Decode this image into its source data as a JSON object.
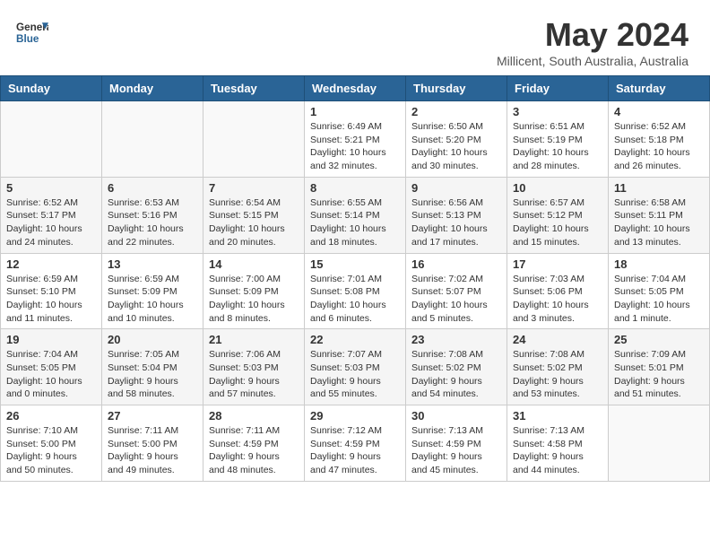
{
  "header": {
    "logo_line1": "General",
    "logo_line2": "Blue",
    "month_year": "May 2024",
    "location": "Millicent, South Australia, Australia"
  },
  "days_of_week": [
    "Sunday",
    "Monday",
    "Tuesday",
    "Wednesday",
    "Thursday",
    "Friday",
    "Saturday"
  ],
  "weeks": [
    [
      {
        "day": "",
        "info": ""
      },
      {
        "day": "",
        "info": ""
      },
      {
        "day": "",
        "info": ""
      },
      {
        "day": "1",
        "info": "Sunrise: 6:49 AM\nSunset: 5:21 PM\nDaylight: 10 hours\nand 32 minutes."
      },
      {
        "day": "2",
        "info": "Sunrise: 6:50 AM\nSunset: 5:20 PM\nDaylight: 10 hours\nand 30 minutes."
      },
      {
        "day": "3",
        "info": "Sunrise: 6:51 AM\nSunset: 5:19 PM\nDaylight: 10 hours\nand 28 minutes."
      },
      {
        "day": "4",
        "info": "Sunrise: 6:52 AM\nSunset: 5:18 PM\nDaylight: 10 hours\nand 26 minutes."
      }
    ],
    [
      {
        "day": "5",
        "info": "Sunrise: 6:52 AM\nSunset: 5:17 PM\nDaylight: 10 hours\nand 24 minutes."
      },
      {
        "day": "6",
        "info": "Sunrise: 6:53 AM\nSunset: 5:16 PM\nDaylight: 10 hours\nand 22 minutes."
      },
      {
        "day": "7",
        "info": "Sunrise: 6:54 AM\nSunset: 5:15 PM\nDaylight: 10 hours\nand 20 minutes."
      },
      {
        "day": "8",
        "info": "Sunrise: 6:55 AM\nSunset: 5:14 PM\nDaylight: 10 hours\nand 18 minutes."
      },
      {
        "day": "9",
        "info": "Sunrise: 6:56 AM\nSunset: 5:13 PM\nDaylight: 10 hours\nand 17 minutes."
      },
      {
        "day": "10",
        "info": "Sunrise: 6:57 AM\nSunset: 5:12 PM\nDaylight: 10 hours\nand 15 minutes."
      },
      {
        "day": "11",
        "info": "Sunrise: 6:58 AM\nSunset: 5:11 PM\nDaylight: 10 hours\nand 13 minutes."
      }
    ],
    [
      {
        "day": "12",
        "info": "Sunrise: 6:59 AM\nSunset: 5:10 PM\nDaylight: 10 hours\nand 11 minutes."
      },
      {
        "day": "13",
        "info": "Sunrise: 6:59 AM\nSunset: 5:09 PM\nDaylight: 10 hours\nand 10 minutes."
      },
      {
        "day": "14",
        "info": "Sunrise: 7:00 AM\nSunset: 5:09 PM\nDaylight: 10 hours\nand 8 minutes."
      },
      {
        "day": "15",
        "info": "Sunrise: 7:01 AM\nSunset: 5:08 PM\nDaylight: 10 hours\nand 6 minutes."
      },
      {
        "day": "16",
        "info": "Sunrise: 7:02 AM\nSunset: 5:07 PM\nDaylight: 10 hours\nand 5 minutes."
      },
      {
        "day": "17",
        "info": "Sunrise: 7:03 AM\nSunset: 5:06 PM\nDaylight: 10 hours\nand 3 minutes."
      },
      {
        "day": "18",
        "info": "Sunrise: 7:04 AM\nSunset: 5:05 PM\nDaylight: 10 hours\nand 1 minute."
      }
    ],
    [
      {
        "day": "19",
        "info": "Sunrise: 7:04 AM\nSunset: 5:05 PM\nDaylight: 10 hours\nand 0 minutes."
      },
      {
        "day": "20",
        "info": "Sunrise: 7:05 AM\nSunset: 5:04 PM\nDaylight: 9 hours\nand 58 minutes."
      },
      {
        "day": "21",
        "info": "Sunrise: 7:06 AM\nSunset: 5:03 PM\nDaylight: 9 hours\nand 57 minutes."
      },
      {
        "day": "22",
        "info": "Sunrise: 7:07 AM\nSunset: 5:03 PM\nDaylight: 9 hours\nand 55 minutes."
      },
      {
        "day": "23",
        "info": "Sunrise: 7:08 AM\nSunset: 5:02 PM\nDaylight: 9 hours\nand 54 minutes."
      },
      {
        "day": "24",
        "info": "Sunrise: 7:08 AM\nSunset: 5:02 PM\nDaylight: 9 hours\nand 53 minutes."
      },
      {
        "day": "25",
        "info": "Sunrise: 7:09 AM\nSunset: 5:01 PM\nDaylight: 9 hours\nand 51 minutes."
      }
    ],
    [
      {
        "day": "26",
        "info": "Sunrise: 7:10 AM\nSunset: 5:00 PM\nDaylight: 9 hours\nand 50 minutes."
      },
      {
        "day": "27",
        "info": "Sunrise: 7:11 AM\nSunset: 5:00 PM\nDaylight: 9 hours\nand 49 minutes."
      },
      {
        "day": "28",
        "info": "Sunrise: 7:11 AM\nSunset: 4:59 PM\nDaylight: 9 hours\nand 48 minutes."
      },
      {
        "day": "29",
        "info": "Sunrise: 7:12 AM\nSunset: 4:59 PM\nDaylight: 9 hours\nand 47 minutes."
      },
      {
        "day": "30",
        "info": "Sunrise: 7:13 AM\nSunset: 4:59 PM\nDaylight: 9 hours\nand 45 minutes."
      },
      {
        "day": "31",
        "info": "Sunrise: 7:13 AM\nSunset: 4:58 PM\nDaylight: 9 hours\nand 44 minutes."
      },
      {
        "day": "",
        "info": ""
      }
    ]
  ]
}
